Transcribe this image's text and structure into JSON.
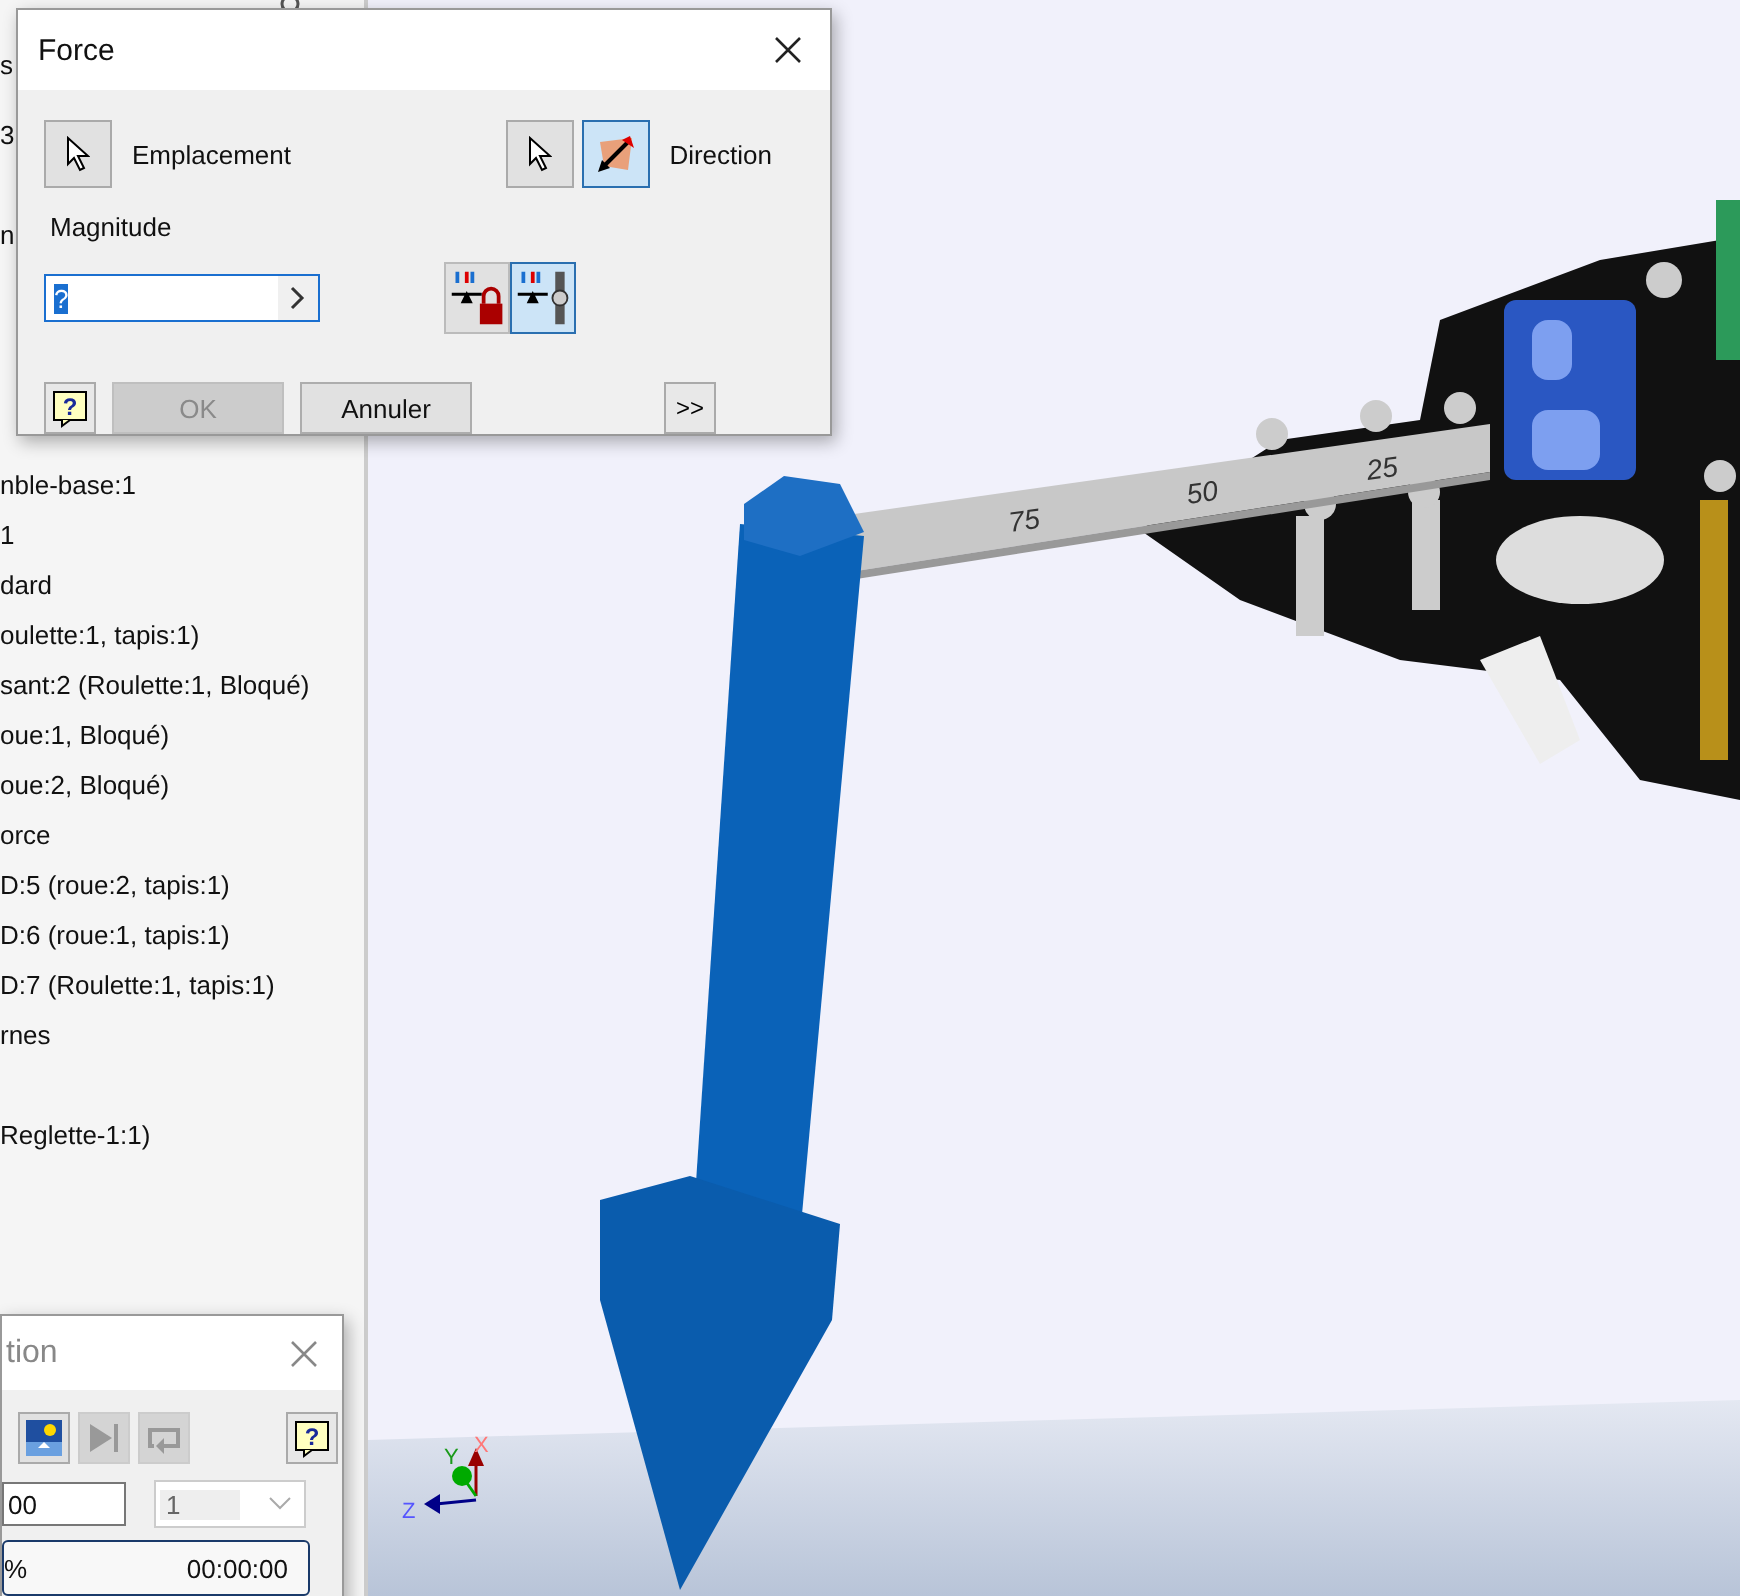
{
  "browser": {
    "top_items": [
      "s",
      "3",
      "n"
    ],
    "items": [
      "nble-base:1",
      "1",
      "dard",
      "oulette:1, tapis:1)",
      "sant:2 (Roulette:1, Bloqué)",
      "oue:1, Bloqué)",
      "oue:2, Bloqué)",
      "orce",
      "D:5 (roue:2, tapis:1)",
      "D:6 (roue:1, tapis:1)",
      "D:7 (Roulette:1, tapis:1)",
      "rnes"
    ],
    "last_item": "Reglette-1:1)"
  },
  "viewport": {
    "ruler_labels": [
      "75",
      "50",
      "25"
    ],
    "axes": [
      "X",
      "Y",
      "Z"
    ]
  },
  "force_dialog": {
    "title": "Force",
    "location": {
      "label": "Emplacement",
      "selected": false
    },
    "direction": {
      "label": "Direction",
      "buttons": [
        {
          "kind": "pointer",
          "selected": false
        },
        {
          "kind": "flip",
          "selected": true
        }
      ]
    },
    "magnitude": {
      "label": "Magnitude",
      "value": "?"
    },
    "toggles": [
      {
        "kind": "lock",
        "selected": false
      },
      {
        "kind": "fixed",
        "selected": true
      }
    ],
    "ok": {
      "label": "OK",
      "disabled": true
    },
    "cancel": {
      "label": "Annuler",
      "disabled": false
    },
    "help": "?",
    "more": ">>"
  },
  "sim_dialog": {
    "title": "tion",
    "tools": [
      {
        "kind": "scene",
        "disabled": false
      },
      {
        "kind": "step",
        "disabled": true
      },
      {
        "kind": "loop",
        "disabled": true
      }
    ],
    "help": "?",
    "value": "00",
    "dropdown": {
      "value": "1",
      "disabled": true
    },
    "progress": "%",
    "level": 0,
    "time": "00:00:00"
  }
}
